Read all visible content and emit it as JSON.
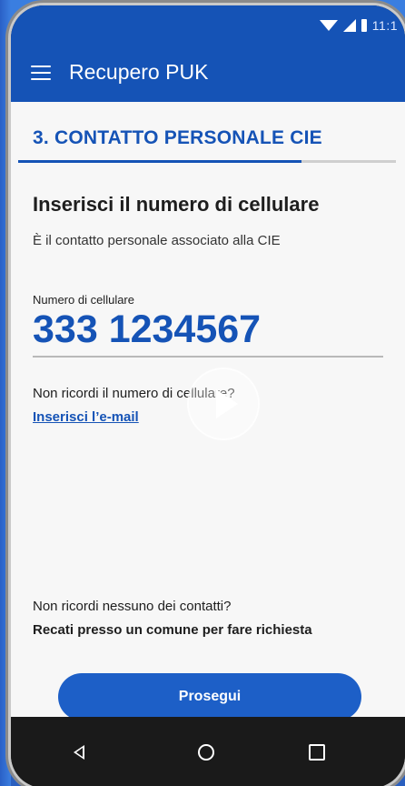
{
  "status_bar": {
    "time": "11:1"
  },
  "app_bar": {
    "title": "Recupero PUK"
  },
  "step": {
    "title": "3. CONTATTO PERSONALE CIE",
    "progress_fraction": 0.75
  },
  "form": {
    "heading": "Inserisci il numero di cellulare",
    "subtext": "È il contatto personale associato alla CIE",
    "phone_label": "Numero di cellulare",
    "phone_value": "333 1234567",
    "forgot_number_question": "Non ricordi il numero di cellulare?",
    "email_link": "Inserisci l’e-mail",
    "no_contacts_question": "Non ricordi nessuno dei contatti?",
    "go_to_office": "Recati presso un comune per fare richiesta",
    "proceed_button": "Prosegui"
  },
  "colors": {
    "primary": "#1553b6",
    "button": "#1d5fc7",
    "background": "#f7f7f7"
  },
  "icons": {
    "menu": "hamburger-menu-icon",
    "play": "play-icon",
    "back": "back-icon",
    "home": "home-icon",
    "recents": "recents-icon"
  }
}
